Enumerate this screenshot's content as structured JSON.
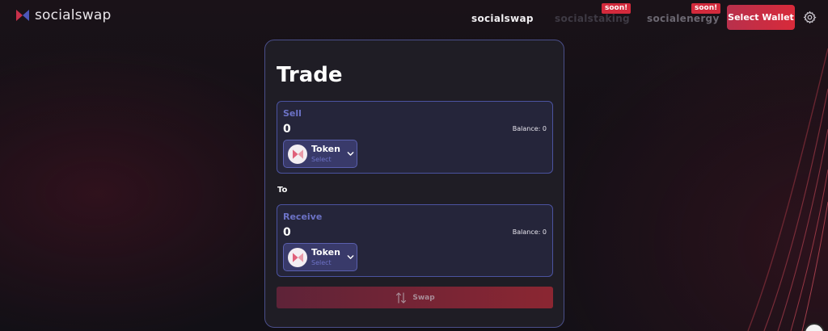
{
  "app": {
    "name": "socialswap"
  },
  "nav": {
    "items": [
      {
        "label": "socialswap"
      },
      {
        "label": "socialstaking",
        "badge": "soon!"
      },
      {
        "label": "socialenergy",
        "badge": "soon!"
      }
    ],
    "wallet_label": "Select Wallet",
    "settings_icon": "gear-icon"
  },
  "trade": {
    "title": "Trade",
    "sell": {
      "label": "Sell",
      "amount": "0",
      "balance": "Balance: 0",
      "token_name": "Token",
      "token_sub": "Select"
    },
    "to_label": "To",
    "receive": {
      "label": "Receive",
      "amount": "0",
      "balance": "Balance: 0",
      "token_name": "Token",
      "token_sub": "Select"
    },
    "swap_label": "Swap"
  },
  "colors": {
    "accent_red": "#d82a3a",
    "accent_blue": "#4b53a0",
    "card_bg": "#1f1d25"
  }
}
